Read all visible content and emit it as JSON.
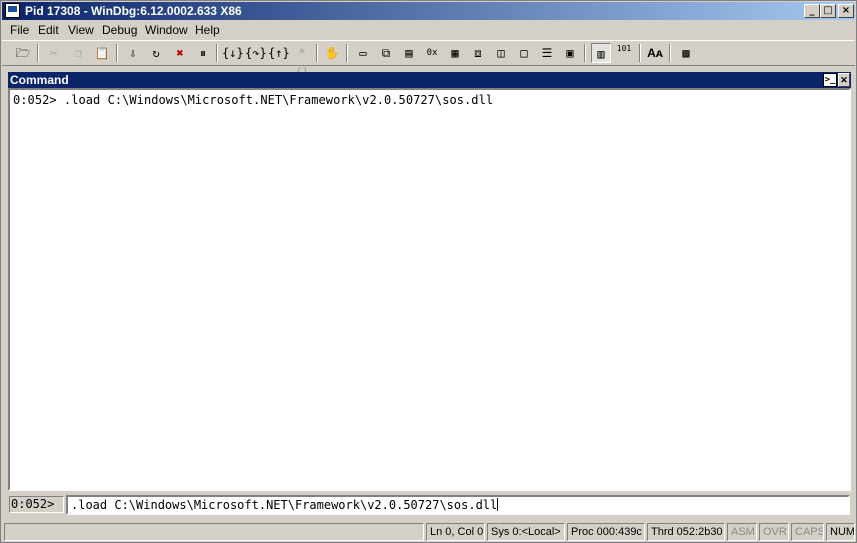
{
  "window": {
    "title": "Pid 17308 - WinDbg:6.12.0002.633 X86",
    "min_glyph": "_",
    "max_glyph": "□",
    "close_glyph": "×"
  },
  "menu": [
    "File",
    "Edit",
    "View",
    "Debug",
    "Window",
    "Help"
  ],
  "toolbar": {
    "items": [
      {
        "icon": "open-folder-icon",
        "glyph": "🗁",
        "enabled": true
      },
      {
        "icon": "cut-icon",
        "glyph": "✂",
        "enabled": false
      },
      {
        "icon": "copy-icon",
        "glyph": "❐",
        "enabled": false
      },
      {
        "icon": "paste-icon",
        "glyph": "📋",
        "enabled": false
      },
      {
        "icon": "go-icon",
        "glyph": "⇩",
        "enabled": true
      },
      {
        "icon": "restart-icon",
        "glyph": "↻",
        "enabled": true
      },
      {
        "icon": "stop-debugging-icon",
        "glyph": "✖",
        "enabled": true
      },
      {
        "icon": "break-icon",
        "glyph": "⏸",
        "enabled": true
      },
      {
        "icon": "step-into-icon",
        "glyph": "{↓}",
        "enabled": true
      },
      {
        "icon": "step-over-icon",
        "glyph": "{↷}",
        "enabled": true
      },
      {
        "icon": "step-out-icon",
        "glyph": "{↑}",
        "enabled": true
      },
      {
        "icon": "run-to-cursor-icon",
        "glyph": "*{}",
        "enabled": false
      },
      {
        "icon": "breakpoint-hand-icon",
        "glyph": "✋",
        "enabled": true
      },
      {
        "icon": "command-window-icon",
        "glyph": "▭",
        "enabled": true
      },
      {
        "icon": "watch-window-icon",
        "glyph": "⧉",
        "enabled": true
      },
      {
        "icon": "locals-window-icon",
        "glyph": "▤",
        "enabled": true
      },
      {
        "icon": "registers-window-icon",
        "glyph": "0x",
        "enabled": true
      },
      {
        "icon": "memory-window-icon",
        "glyph": "▦",
        "enabled": true
      },
      {
        "icon": "call-stack-window-icon",
        "glyph": "⧈",
        "enabled": true
      },
      {
        "icon": "disassembly-window-icon",
        "glyph": "◫",
        "enabled": true
      },
      {
        "icon": "scratch-pad-icon",
        "glyph": "□",
        "enabled": true
      },
      {
        "icon": "processes-threads-icon",
        "glyph": "☰",
        "enabled": true
      },
      {
        "icon": "command-browser-icon",
        "glyph": "▣",
        "enabled": true
      },
      {
        "icon": "source-mode-icon",
        "glyph": "▥",
        "enabled": true
      },
      {
        "icon": "binary-mode-icon",
        "glyph": "101",
        "enabled": true
      },
      {
        "icon": "font-icon",
        "glyph": "Aᴀ",
        "enabled": true
      },
      {
        "icon": "options-icon",
        "glyph": "▩",
        "enabled": true
      }
    ]
  },
  "command_window": {
    "title": "Command",
    "output": "0:052> .load C:\\Windows\\Microsoft.NET\\Framework\\v2.0.50727\\sos.dll",
    "prompt": "0:052>",
    "input_value": ".load C:\\Windows\\Microsoft.NET\\Framework\\v2.0.50727\\sos.dll"
  },
  "statusbar": {
    "ln_col": "Ln 0, Col 0",
    "sys": "Sys 0:<Local>",
    "proc": "Proc 000:439c",
    "thrd": "Thrd 052:2b30",
    "asm": "ASM",
    "ovr": "OVR",
    "caps": "CAPS",
    "num": "NUM"
  }
}
